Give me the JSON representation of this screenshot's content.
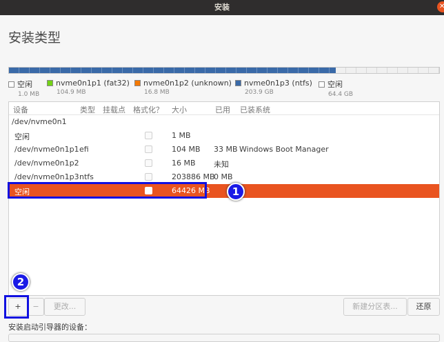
{
  "window": {
    "title": "安装",
    "close_icon": "close-icon"
  },
  "page": {
    "heading": "安装类型"
  },
  "partition_bar": {
    "segments": [
      {
        "name": "free1",
        "fraction": 0.0,
        "color": "#ffffff"
      },
      {
        "name": "p1",
        "fraction": 0.0004,
        "color": "#73d216"
      },
      {
        "name": "p2",
        "fraction": 0.0001,
        "color": "#f57900"
      },
      {
        "name": "p3",
        "fraction": 0.76,
        "color": "#3a6aa8"
      },
      {
        "name": "free2",
        "fraction": 0.24,
        "color": "#f0f0f0"
      }
    ]
  },
  "legend": [
    {
      "label": "空闲",
      "size": "1.0 MB",
      "color": "#ffffff"
    },
    {
      "label": "nvme0n1p1 (fat32)",
      "size": "104.9 MB",
      "color": "#73d216"
    },
    {
      "label": "nvme0n1p2 (unknown)",
      "size": "16.8 MB",
      "color": "#f57900"
    },
    {
      "label": "nvme0n1p3 (ntfs)",
      "size": "203.9 GB",
      "color": "#3a6aa8"
    },
    {
      "label": "空闲",
      "size": "64.4 GB",
      "color": "#ffffff"
    }
  ],
  "table": {
    "headers": [
      "设备",
      "类型",
      "挂载点",
      "格式化？",
      "大小",
      "已用",
      "已装系统"
    ],
    "disk": "/dev/nvme0n1",
    "rows": [
      {
        "device": "空闲",
        "type": "",
        "mount": "",
        "size": "1 MB",
        "used": "",
        "os": ""
      },
      {
        "device": "/dev/nvme0n1p1",
        "type": "efi",
        "mount": "",
        "size": "104 MB",
        "used": "33 MB",
        "os": "Windows Boot Manager"
      },
      {
        "device": "/dev/nvme0n1p2",
        "type": "",
        "mount": "",
        "size": "16 MB",
        "used": "未知",
        "os": ""
      },
      {
        "device": "/dev/nvme0n1p3",
        "type": "ntfs",
        "mount": "",
        "size": "203886 MB",
        "used": "0 MB",
        "os": ""
      },
      {
        "device": "空闲",
        "type": "",
        "mount": "",
        "size": "64426 MB",
        "used": "",
        "os": "",
        "selected": true
      }
    ]
  },
  "buttons": {
    "add": "+",
    "remove": "−",
    "change": "更改...",
    "new_table": "新建分区表...",
    "revert": "还原"
  },
  "bootloader_label": "安装启动引导器的设备：",
  "annotations": [
    "1",
    "2"
  ]
}
